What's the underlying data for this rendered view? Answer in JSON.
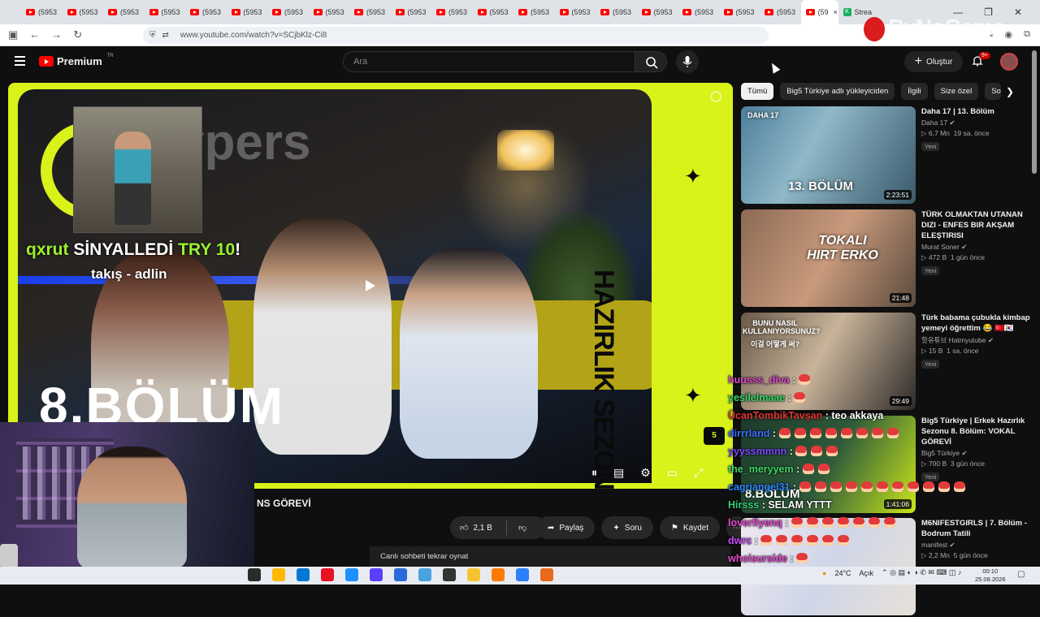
{
  "browser": {
    "tabs": [
      {
        "label": "(5953"
      },
      {
        "label": "(5953"
      },
      {
        "label": "(5953"
      },
      {
        "label": "(5953"
      },
      {
        "label": "(5953"
      },
      {
        "label": "(5953"
      },
      {
        "label": "(5953"
      },
      {
        "label": "(5953"
      },
      {
        "label": "(5953"
      },
      {
        "label": "(5953"
      },
      {
        "label": "(5953"
      },
      {
        "label": "(5953"
      },
      {
        "label": "(5953"
      },
      {
        "label": "(5953"
      },
      {
        "label": "(5953"
      },
      {
        "label": "(5953"
      },
      {
        "label": "(5953"
      },
      {
        "label": "(5953"
      },
      {
        "label": "(5953"
      }
    ],
    "active_tab": {
      "label": "(59",
      "close": "×"
    },
    "other_tab": {
      "label": "Strea",
      "icon": "K"
    },
    "url": "www.youtube.com/watch?v=SCjbKlz-Ci8",
    "window_controls": {
      "minimize": "—",
      "maximize": "❐",
      "close": "✕"
    }
  },
  "watermark": {
    "text": "ByNoGame"
  },
  "youtube": {
    "brand": "Premium",
    "brand_sup": "TR",
    "search_placeholder": "Ara",
    "create_label": "Oluştur",
    "notification_badge": "9+"
  },
  "video": {
    "brand_overlay": "ypers",
    "alert_user": "qxrut",
    "alert_verb": "SİNYALLEDİ",
    "alert_amount": "TRY 10",
    "alert_bang": "!",
    "alert_sub": "takış - adlin",
    "big_text": "8.BÖLÜM",
    "side_text": "HAZIRLIK SEZONU",
    "b5": "5"
  },
  "below_player": {
    "title": "NS GÖREVİ",
    "like_count": "2,1 B",
    "share_label": "Paylaş",
    "ask_label": "Soru",
    "save_label": "Kaydet",
    "more": "⋯",
    "chat_replay": "Canlı sohbeti tekrar oynat"
  },
  "chips": [
    {
      "label": "Tümü",
      "active": true
    },
    {
      "label": "Big5 Türkiye adlı yükleyiciden"
    },
    {
      "label": "İlgili"
    },
    {
      "label": "Size özel"
    },
    {
      "label": "Sor"
    }
  ],
  "recommendations": [
    {
      "title": "Daha 17 | 13. Bölüm",
      "channel": "Daha 17",
      "views": "▷ 6,7 Mn",
      "age": "19 sa. önce",
      "badge": "Yeni",
      "duration": "2:23:51",
      "thumb_text": "13. BÖLÜM",
      "thumb_top": "DAHA 17"
    },
    {
      "title": "TÜRK OLMAKTAN UTANAN DIZI - ENFES BIR AKŞAM ELEŞTIRISI",
      "channel": "Murat Soner",
      "views": "▷ 472 B",
      "age": "1 gün önce",
      "badge": "Yeni",
      "duration": "21:48",
      "thumb_text": "TOKALI HIRT ERKO"
    },
    {
      "title": "Türk babama çubukla kimbap yemeyi öğrettim 😂 🇹🇷🇰🇷",
      "channel": "핫유튜브 Hatmyutube",
      "views": "▷ 15 B",
      "age": "1 sa. önce",
      "badge": "Yeni",
      "duration": "29:49",
      "thumb_text": "BUNU NASIL KULLANIYORSUNUZ?",
      "thumb_sub": "이걸 어떻게 써?"
    },
    {
      "title": "Big5 Türkiye | Erkek Hazırlık Sezonu 8. Bölüm: VOKAL GÖREVİ",
      "channel": "Big5 Türkiye",
      "views": "▷ 700 B",
      "age": "3 gün önce",
      "badge": "Yeni",
      "duration": "1:41:06",
      "thumb_text": "8.BÖLÜM"
    },
    {
      "title": "M6NIFESTGIRLS | 7. Bölüm - Bodrum Tatili",
      "channel": "manifest",
      "views": "▷ 2,2 Mn",
      "age": "5 gün önce",
      "badge": "",
      "duration": "",
      "thumb_text": ""
    }
  ],
  "chat": [
    {
      "user": "huusss_diva",
      "color": "#e14bd0",
      "msg": "",
      "emotes": 1
    },
    {
      "user": "yesilelmaae",
      "color": "#39d86b",
      "msg": "",
      "emotes": 1
    },
    {
      "user": "ÜcanTombikTavşan",
      "color": "#e23535",
      "msg": "teo akkaya",
      "emotes": 0
    },
    {
      "user": "dirrrland",
      "color": "#3f6fff",
      "msg": "",
      "emotes": 8
    },
    {
      "user": "yyyssmmnn",
      "color": "#7a4bff",
      "msg": "",
      "emotes": 3
    },
    {
      "user": "the_meryyem",
      "color": "#42d86a",
      "msg": "",
      "emotes": 2
    },
    {
      "user": "cagriangel31",
      "color": "#2f86ff",
      "msg": "",
      "emotes": 11
    },
    {
      "user": "Hirsss",
      "color": "#36d07a",
      "msg": "SELAM YTTT",
      "emotes": 0
    },
    {
      "user": "loverfiyenq",
      "color": "#e84bd0",
      "msg": "",
      "emotes": 7
    },
    {
      "user": "dwrc",
      "color": "#c84bff",
      "msg": "",
      "emotes": 6
    },
    {
      "user": "whoisurside",
      "color": "#e84bd0",
      "msg": "",
      "emotes": 1
    }
  ],
  "taskbar": {
    "weather": "24°C",
    "weather_desc": "Açık",
    "time": "00:10",
    "date": "25.08.2026"
  },
  "colors": {
    "accent": "#d8f21a",
    "yt_red": "#ff0000"
  }
}
